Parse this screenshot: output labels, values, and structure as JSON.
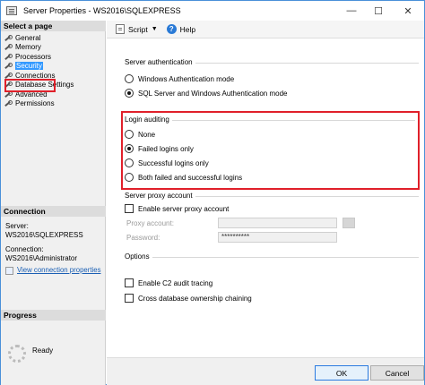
{
  "window": {
    "title": "Server Properties - WS2016\\SQLEXPRESS",
    "minimize_glyph": "—",
    "maximize_glyph": "☐",
    "close_glyph": "✕"
  },
  "left_panel": {
    "select_page_header": "Select a page",
    "pages": [
      {
        "label": "General",
        "selected": false
      },
      {
        "label": "Memory",
        "selected": false
      },
      {
        "label": "Processors",
        "selected": false
      },
      {
        "label": "Security",
        "selected": true
      },
      {
        "label": "Connections",
        "selected": false
      },
      {
        "label": "Database Settings",
        "selected": false
      },
      {
        "label": "Advanced",
        "selected": false
      },
      {
        "label": "Permissions",
        "selected": false
      }
    ],
    "connection_header": "Connection",
    "server_label": "Server:",
    "server_value": "WS2016\\SQLEXPRESS",
    "connection_label": "Connection:",
    "connection_value": "WS2016\\Administrator",
    "view_connection_link": "View connection properties",
    "progress_header": "Progress",
    "progress_status": "Ready"
  },
  "toolbar": {
    "script_label": "Script",
    "dropdown_glyph": "▼",
    "help_label": "Help",
    "help_glyph": "?"
  },
  "server_authentication": {
    "group_label": "Server authentication",
    "options": [
      {
        "label": "Windows Authentication mode",
        "checked": false
      },
      {
        "label": "SQL Server and Windows Authentication mode",
        "checked": true
      }
    ]
  },
  "login_auditing": {
    "group_label": "Login auditing",
    "options": [
      {
        "label": "None",
        "checked": false
      },
      {
        "label": "Failed logins only",
        "checked": true
      },
      {
        "label": "Successful logins only",
        "checked": false
      },
      {
        "label": "Both failed and successful logins",
        "checked": false
      }
    ]
  },
  "server_proxy": {
    "group_label": "Server proxy account",
    "enable_label": "Enable server proxy account",
    "enable_checked": false,
    "proxy_account_label": "Proxy account:",
    "proxy_account_value": "",
    "password_label": "Password:",
    "password_value": "**********"
  },
  "options": {
    "group_label": "Options",
    "c2_label": "Enable C2 audit tracing",
    "c2_checked": false,
    "cross_db_label": "Cross database ownership chaining",
    "cross_db_checked": false
  },
  "buttons": {
    "ok_label": "OK",
    "cancel_label": "Cancel"
  },
  "colors": {
    "highlight_red": "#e0202a",
    "selection_blue": "#3399ff",
    "link_blue": "#1a5fb4"
  }
}
